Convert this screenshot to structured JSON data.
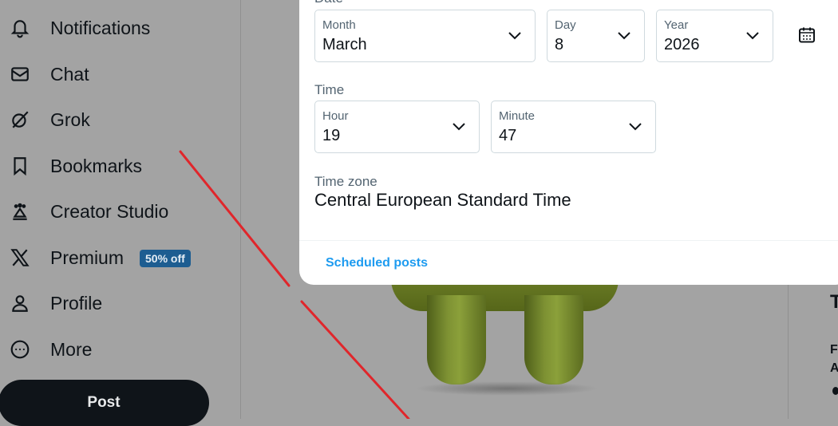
{
  "nav": {
    "items": [
      {
        "label": "Notifications",
        "icon": "bell-icon"
      },
      {
        "label": "Chat",
        "icon": "envelope-icon"
      },
      {
        "label": "Grok",
        "icon": "grok-icon"
      },
      {
        "label": "Bookmarks",
        "icon": "bookmark-icon"
      },
      {
        "label": "Creator Studio",
        "icon": "creator-studio-icon"
      },
      {
        "label": "Premium",
        "icon": "x-logo-icon",
        "badge": "50% off"
      },
      {
        "label": "Profile",
        "icon": "person-icon"
      },
      {
        "label": "More",
        "icon": "more-circle-icon"
      }
    ],
    "post_label": "Post"
  },
  "schedule": {
    "date_heading": "Date",
    "month": {
      "label": "Month",
      "value": "March"
    },
    "day": {
      "label": "Day",
      "value": "8"
    },
    "year": {
      "label": "Year",
      "value": "2026"
    },
    "time_heading": "Time",
    "hour": {
      "label": "Hour",
      "value": "19"
    },
    "minute": {
      "label": "Minute",
      "value": "47"
    },
    "timezone_label": "Time zone",
    "timezone_value": "Central European Standard Time",
    "scheduled_posts_link": "Scheduled posts",
    "calendar_icon": "calendar-icon"
  },
  "background": {
    "right_fragments": [
      "T",
      "F",
      "A"
    ]
  },
  "colors": {
    "accent": "#1d9bf0",
    "badge": "#1d5d91",
    "annotation_line": "#e0262b",
    "overlay": "#a3a3a3"
  }
}
